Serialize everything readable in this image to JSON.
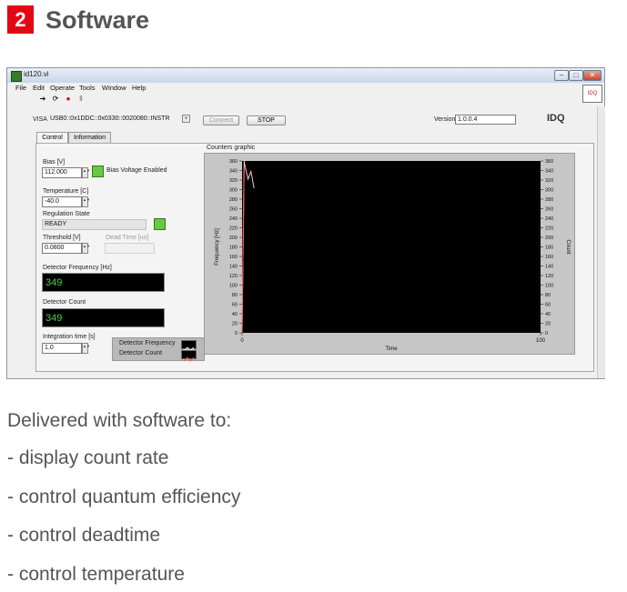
{
  "section": {
    "number": "2",
    "title": "Software"
  },
  "window": {
    "title": "id120.vi",
    "menu": [
      "File",
      "Edit",
      "Operate",
      "Tools",
      "Window",
      "Help"
    ]
  },
  "controls": {
    "visa_label": "VISA",
    "visa_value": "USB0::0x1DDC::0x0330::0020080::INSTR",
    "connect_label": "Connect",
    "stop_label": "STOP",
    "version_label": "Version",
    "version_value": "1.0.0.4",
    "logo_text": "IDQ",
    "tabs": [
      "Control",
      "Information"
    ],
    "bias_label": "Bias [V]",
    "bias_value": "112.000",
    "bias_enabled_label": "Bias Voltage Enabled",
    "temp_label": "Temperature [C]",
    "temp_value": "-40.0",
    "regulation_label": "Regulation State",
    "regulation_value": "READY",
    "threshold_label": "Threshold [V]",
    "threshold_value": "0.0800",
    "deadtime_label": "Dead Time [us]",
    "det_freq_label": "Detector Frequency [Hz]",
    "det_freq_value": "349",
    "det_count_label": "Detector Count",
    "det_count_value": "349",
    "integration_label": "Integration time [s]",
    "integration_value": "1.0",
    "legend": [
      "Detector Frequency",
      "Detector Count"
    ]
  },
  "chart_data": {
    "type": "line",
    "title": "Counters graphic",
    "xlabel": "Time",
    "ylabel": "Frequency [Hz]",
    "y2label": "Count",
    "xlim": [
      0,
      100
    ],
    "ylim": [
      0,
      360
    ],
    "x_ticks": [
      "0",
      "100"
    ],
    "y_ticks": [
      0,
      20,
      40,
      60,
      80,
      100,
      120,
      140,
      160,
      180,
      200,
      220,
      240,
      260,
      280,
      300,
      320,
      340,
      360
    ],
    "series": [
      {
        "name": "Detector Frequency",
        "x": [
          0,
          0.7,
          1,
          2,
          3,
          4
        ],
        "y": [
          0,
          360,
          349,
          322,
          338,
          303
        ],
        "color": "#f4c7d7"
      },
      {
        "name": "Detector Count",
        "x": [
          0,
          0.7,
          1
        ],
        "y": [
          0,
          345,
          349
        ],
        "color": "#ff5a5a"
      }
    ]
  },
  "body": {
    "intro": "Delivered with software to:",
    "items": [
      "- display count rate",
      "- control quantum efficiency",
      "- control deadtime",
      "- control temperature"
    ]
  }
}
